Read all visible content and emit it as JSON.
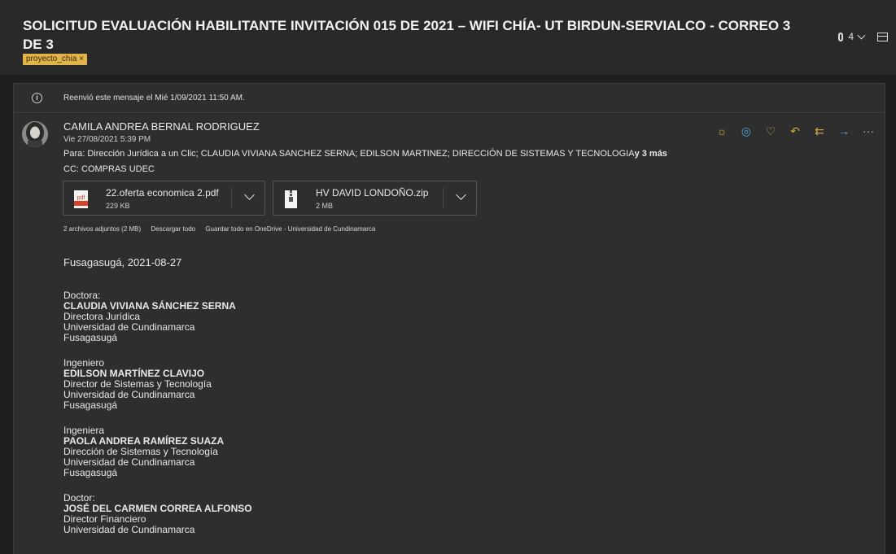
{
  "subject": "SOLICITUD EVALUACIÓN HABILITANTE INVITACIÓN 015 DE 2021 – WIFI CHÍA- UT BIRDUN-SERVIALCO - CORREO 3 DE 3",
  "tag": {
    "label": "proyecto_chia",
    "close": "×"
  },
  "header_right": {
    "attachment_count": "4"
  },
  "notice": "Reenvió este mensaje el Mié 1/09/2021 11:50 AM.",
  "sender": {
    "name": "CAMILA ANDREA BERNAL RODRIGUEZ",
    "date": "Vie 27/08/2021 5:39 PM"
  },
  "recipients": {
    "to_label": "Para:",
    "to": "Dirección Jurídica a un Clic; CLAUDIA VIVIANA SANCHEZ SERNA; EDILSON MARTINEZ; DIRECCIÓN DE SISTEMAS Y TECNOLOGIA",
    "more": "y 3 más",
    "cc_label": "CC:",
    "cc": "COMPRAS UDEC"
  },
  "attachments": [
    {
      "name": "22.oferta economica 2.pdf",
      "size": "229 KB",
      "icon": "pdf-icon",
      "icon_label": "pdf"
    },
    {
      "name": "HV DAVID LONDOÑO.zip",
      "size": "2 MB",
      "icon": "zip-icon"
    }
  ],
  "attachment_bar": {
    "summary": "2 archivos adjuntos (2 MB)",
    "download_all": "Descargar todo",
    "save_all": "Guardar todo en OneDrive - Universidad de Cundinamarca"
  },
  "body": {
    "place_date": "Fusagasugá, 2021-08-27",
    "addressees": [
      {
        "title": "Doctora:",
        "name": "CLAUDIA VIVIANA SÁNCHEZ SERNA",
        "role": "Directora Jurídica",
        "org": "Universidad de Cundinamarca",
        "city": "Fusagasugá"
      },
      {
        "title": "Ingeniero",
        "name": "EDILSON MARTÍNEZ CLAVIJO",
        "role": "Director de Sistemas y Tecnología",
        "org": "Universidad de Cundinamarca",
        "city": "Fusagasugá"
      },
      {
        "title": "Ingeniera",
        "name": "PAOLA ANDREA RAMÍREZ SUAZA",
        "role": "Dirección de Sistemas y Tecnología",
        "org": "Universidad de Cundinamarca",
        "city": "Fusagasugá"
      },
      {
        "title": "Doctor:",
        "name": "JOSÉ DEL CARMEN CORREA ALFONSO",
        "role": "Director Financiero",
        "org": "Universidad de Cundinamarca",
        "city": ""
      }
    ]
  },
  "colors": {
    "background": "#1e1e1e",
    "header": "#292929",
    "card": "#2e2e2e",
    "tag": "#e0b44a",
    "action_gold": "#d6a84a",
    "action_blue": "#4aa3d6"
  },
  "icons": {
    "actions": [
      "sun-icon",
      "loop-icon",
      "like-icon",
      "reply-icon",
      "reply-all-icon",
      "forward-icon",
      "more-icon"
    ]
  }
}
